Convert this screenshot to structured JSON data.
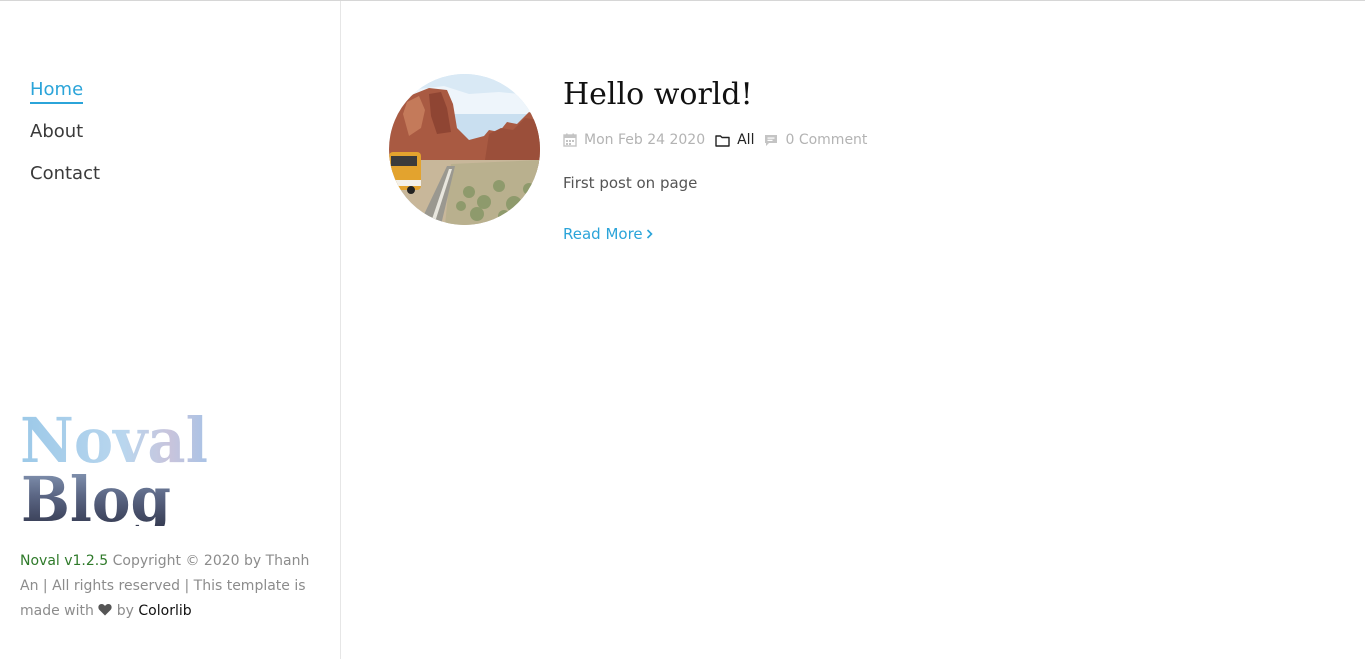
{
  "nav": {
    "items": [
      {
        "label": "Home",
        "active": true
      },
      {
        "label": "About",
        "active": false
      },
      {
        "label": "Contact",
        "active": false
      }
    ]
  },
  "logo": {
    "line1": "Noval",
    "line2": "Blog"
  },
  "footer": {
    "version": "Noval v1.2.5",
    "copyright": " Copyright © 2020 by Thanh An | All rights reserved | This template is made with ",
    "heart_icon": "heart-icon",
    "by": " by ",
    "author_link": "Colorlib"
  },
  "post": {
    "title": "Hello world!",
    "date": "Mon Feb 24 2020",
    "category": "All",
    "comments": "0 Comment",
    "excerpt": "First post on page",
    "read_more": "Read More",
    "icons": [
      "calendar-icon",
      "folder-icon",
      "comment-icon",
      "chevron-right-icon"
    ]
  },
  "colors": {
    "accent": "#2ba4d9",
    "version_green": "#2f7a2a",
    "meta_gray": "#b3b3b3"
  }
}
